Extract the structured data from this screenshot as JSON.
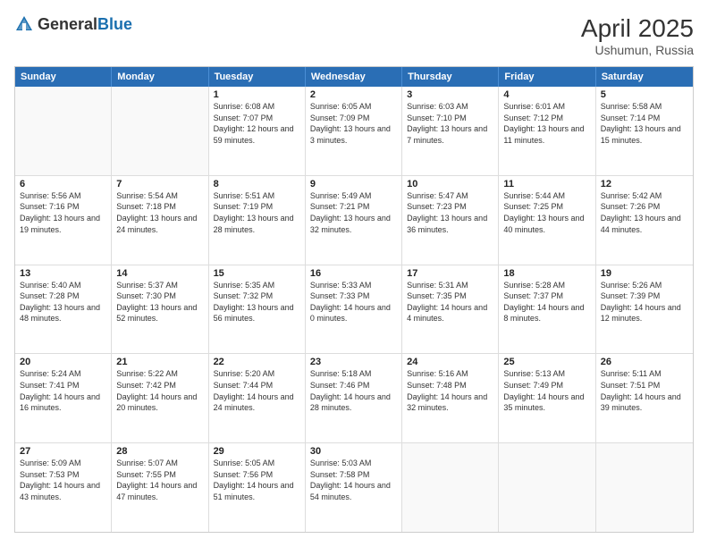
{
  "header": {
    "logo_general": "General",
    "logo_blue": "Blue",
    "title": "April 2025",
    "location": "Ushumun, Russia"
  },
  "days_of_week": [
    "Sunday",
    "Monday",
    "Tuesday",
    "Wednesday",
    "Thursday",
    "Friday",
    "Saturday"
  ],
  "weeks": [
    [
      {
        "day": "",
        "info": ""
      },
      {
        "day": "",
        "info": ""
      },
      {
        "day": "1",
        "info": "Sunrise: 6:08 AM\nSunset: 7:07 PM\nDaylight: 12 hours and 59 minutes."
      },
      {
        "day": "2",
        "info": "Sunrise: 6:05 AM\nSunset: 7:09 PM\nDaylight: 13 hours and 3 minutes."
      },
      {
        "day": "3",
        "info": "Sunrise: 6:03 AM\nSunset: 7:10 PM\nDaylight: 13 hours and 7 minutes."
      },
      {
        "day": "4",
        "info": "Sunrise: 6:01 AM\nSunset: 7:12 PM\nDaylight: 13 hours and 11 minutes."
      },
      {
        "day": "5",
        "info": "Sunrise: 5:58 AM\nSunset: 7:14 PM\nDaylight: 13 hours and 15 minutes."
      }
    ],
    [
      {
        "day": "6",
        "info": "Sunrise: 5:56 AM\nSunset: 7:16 PM\nDaylight: 13 hours and 19 minutes."
      },
      {
        "day": "7",
        "info": "Sunrise: 5:54 AM\nSunset: 7:18 PM\nDaylight: 13 hours and 24 minutes."
      },
      {
        "day": "8",
        "info": "Sunrise: 5:51 AM\nSunset: 7:19 PM\nDaylight: 13 hours and 28 minutes."
      },
      {
        "day": "9",
        "info": "Sunrise: 5:49 AM\nSunset: 7:21 PM\nDaylight: 13 hours and 32 minutes."
      },
      {
        "day": "10",
        "info": "Sunrise: 5:47 AM\nSunset: 7:23 PM\nDaylight: 13 hours and 36 minutes."
      },
      {
        "day": "11",
        "info": "Sunrise: 5:44 AM\nSunset: 7:25 PM\nDaylight: 13 hours and 40 minutes."
      },
      {
        "day": "12",
        "info": "Sunrise: 5:42 AM\nSunset: 7:26 PM\nDaylight: 13 hours and 44 minutes."
      }
    ],
    [
      {
        "day": "13",
        "info": "Sunrise: 5:40 AM\nSunset: 7:28 PM\nDaylight: 13 hours and 48 minutes."
      },
      {
        "day": "14",
        "info": "Sunrise: 5:37 AM\nSunset: 7:30 PM\nDaylight: 13 hours and 52 minutes."
      },
      {
        "day": "15",
        "info": "Sunrise: 5:35 AM\nSunset: 7:32 PM\nDaylight: 13 hours and 56 minutes."
      },
      {
        "day": "16",
        "info": "Sunrise: 5:33 AM\nSunset: 7:33 PM\nDaylight: 14 hours and 0 minutes."
      },
      {
        "day": "17",
        "info": "Sunrise: 5:31 AM\nSunset: 7:35 PM\nDaylight: 14 hours and 4 minutes."
      },
      {
        "day": "18",
        "info": "Sunrise: 5:28 AM\nSunset: 7:37 PM\nDaylight: 14 hours and 8 minutes."
      },
      {
        "day": "19",
        "info": "Sunrise: 5:26 AM\nSunset: 7:39 PM\nDaylight: 14 hours and 12 minutes."
      }
    ],
    [
      {
        "day": "20",
        "info": "Sunrise: 5:24 AM\nSunset: 7:41 PM\nDaylight: 14 hours and 16 minutes."
      },
      {
        "day": "21",
        "info": "Sunrise: 5:22 AM\nSunset: 7:42 PM\nDaylight: 14 hours and 20 minutes."
      },
      {
        "day": "22",
        "info": "Sunrise: 5:20 AM\nSunset: 7:44 PM\nDaylight: 14 hours and 24 minutes."
      },
      {
        "day": "23",
        "info": "Sunrise: 5:18 AM\nSunset: 7:46 PM\nDaylight: 14 hours and 28 minutes."
      },
      {
        "day": "24",
        "info": "Sunrise: 5:16 AM\nSunset: 7:48 PM\nDaylight: 14 hours and 32 minutes."
      },
      {
        "day": "25",
        "info": "Sunrise: 5:13 AM\nSunset: 7:49 PM\nDaylight: 14 hours and 35 minutes."
      },
      {
        "day": "26",
        "info": "Sunrise: 5:11 AM\nSunset: 7:51 PM\nDaylight: 14 hours and 39 minutes."
      }
    ],
    [
      {
        "day": "27",
        "info": "Sunrise: 5:09 AM\nSunset: 7:53 PM\nDaylight: 14 hours and 43 minutes."
      },
      {
        "day": "28",
        "info": "Sunrise: 5:07 AM\nSunset: 7:55 PM\nDaylight: 14 hours and 47 minutes."
      },
      {
        "day": "29",
        "info": "Sunrise: 5:05 AM\nSunset: 7:56 PM\nDaylight: 14 hours and 51 minutes."
      },
      {
        "day": "30",
        "info": "Sunrise: 5:03 AM\nSunset: 7:58 PM\nDaylight: 14 hours and 54 minutes."
      },
      {
        "day": "",
        "info": ""
      },
      {
        "day": "",
        "info": ""
      },
      {
        "day": "",
        "info": ""
      }
    ]
  ]
}
